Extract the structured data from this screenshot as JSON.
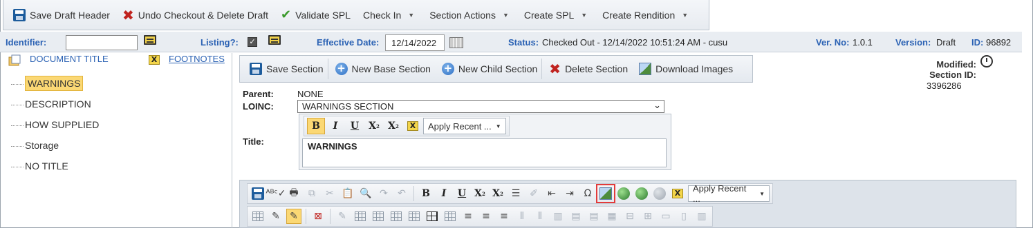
{
  "toolbar": {
    "save_draft_header": "Save Draft Header",
    "undo_checkout": "Undo Checkout & Delete Draft",
    "validate_spl": "Validate SPL",
    "check_in": "Check In",
    "section_actions": "Section Actions",
    "create_spl": "Create SPL",
    "create_rendition": "Create Rendition"
  },
  "info": {
    "identifier_label": "Identifier:",
    "identifier_value": "",
    "listing_label": "Listing?:",
    "effective_date_label": "Effective Date:",
    "effective_date_value": "12/14/2022",
    "status_label": "Status:",
    "status_value": "Checked Out - 12/14/2022 10:51:24 AM - cusu",
    "ver_no_label": "Ver. No:",
    "ver_no_value": "1.0.1",
    "version_label": "Version:",
    "version_value": "Draft",
    "id_label": "ID:",
    "id_value": "96892"
  },
  "tree": {
    "document_title": "DOCUMENT TITLE",
    "footnotes": "FOOTNOTES",
    "items": [
      {
        "label": "WARNINGS",
        "selected": true
      },
      {
        "label": "DESCRIPTION",
        "selected": false
      },
      {
        "label": "HOW SUPPLIED",
        "selected": false
      },
      {
        "label": "Storage",
        "selected": false
      },
      {
        "label": "NO TITLE",
        "selected": false
      }
    ]
  },
  "section_toolbar": {
    "save_section": "Save Section",
    "new_base_section": "New Base Section",
    "new_child_section": "New Child Section",
    "delete_section": "Delete Section",
    "download_images": "Download Images"
  },
  "meta": {
    "modified_label": "Modified:",
    "section_id_label": "Section ID:",
    "section_id_value": "3396286"
  },
  "form": {
    "parent_label": "Parent:",
    "parent_value": "NONE",
    "loinc_label": "LOINC:",
    "loinc_value": "WARNINGS SECTION",
    "title_label": "Title:",
    "title_value": "WARNINGS",
    "apply_recent": "Apply Recent ..."
  },
  "editor": {
    "apply_recent": "Apply Recent ..."
  }
}
